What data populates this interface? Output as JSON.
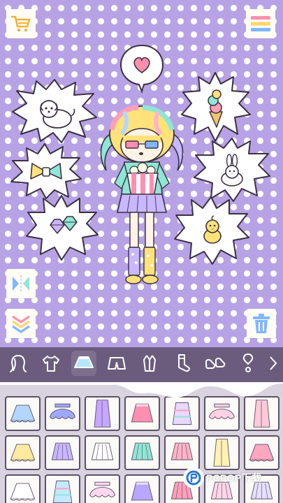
{
  "app": {
    "screen": "dress-up-editor"
  },
  "colors": {
    "toolbar": "#6b5c7e",
    "background": "#b7a2e6",
    "panel": "#d8d3de",
    "pink": "#ff8fb1",
    "mint": "#7ee6c9",
    "yellow": "#ffe27a"
  },
  "top_bar": {
    "left_icon": "shopping-cart-icon",
    "right_icon": "menu-stripes-icon"
  },
  "speech_bubble": {
    "icon": "heart-icon"
  },
  "stickers": [
    {
      "name": "dog-icon"
    },
    {
      "name": "bow-icon"
    },
    {
      "name": "gems-icon"
    },
    {
      "name": "ice-cream-icon"
    },
    {
      "name": "bunny-icon"
    },
    {
      "name": "chick-icon"
    }
  ],
  "side_buttons": {
    "flip": "flip-icon",
    "down": "chevron-down-icon",
    "trash": "trash-icon"
  },
  "categories": [
    {
      "name": "hair-icon",
      "active": false
    },
    {
      "name": "shirt-icon",
      "active": false
    },
    {
      "name": "skirt-icon",
      "active": true
    },
    {
      "name": "shorts-icon",
      "active": false
    },
    {
      "name": "outfit-icon",
      "active": false
    },
    {
      "name": "socks-icon",
      "active": false
    },
    {
      "name": "shoes-icon",
      "active": false
    },
    {
      "name": "accessory-icon",
      "active": false
    },
    {
      "name": "extra-icon",
      "active": false
    }
  ],
  "items": [
    {
      "color": "#b3d6ff",
      "style": "flare"
    },
    {
      "color": "#9fa8ff",
      "style": "tutu"
    },
    {
      "color": "#c7a6ff",
      "style": "long"
    },
    {
      "color": "#ff8fb1",
      "style": "aline"
    },
    {
      "color": "#e9d8ff",
      "style": "stripe"
    },
    {
      "color": "#ffd1e3",
      "style": "tutu"
    },
    {
      "color": "#ffc9d9",
      "style": "long"
    },
    {
      "color": "#ffeaa0",
      "style": "flare"
    },
    {
      "color": "#c9b7ff",
      "style": "pleat"
    },
    {
      "color": "#ffffff",
      "style": "pleat"
    },
    {
      "color": "#8ee6d4",
      "style": "pleat"
    },
    {
      "color": "#ffb3c7",
      "style": "pleat"
    },
    {
      "color": "#fff2b3",
      "style": "long"
    },
    {
      "color": "#ffa7c0",
      "style": "flare"
    },
    {
      "color": "#ffffff",
      "style": "flare"
    },
    {
      "color": "#c2e9ff",
      "style": "stripe"
    },
    {
      "color": "#ffd8f0",
      "style": "tutu"
    },
    {
      "color": "#b8a6ff",
      "style": "aline"
    },
    {
      "color": "#ff9fb9",
      "style": "pleat"
    },
    {
      "color": "#ffd6e6",
      "style": "pleat"
    },
    {
      "color": "#e5e0ff",
      "style": "pleat"
    }
  ],
  "watermark": {
    "text": "PCPOP下载"
  }
}
